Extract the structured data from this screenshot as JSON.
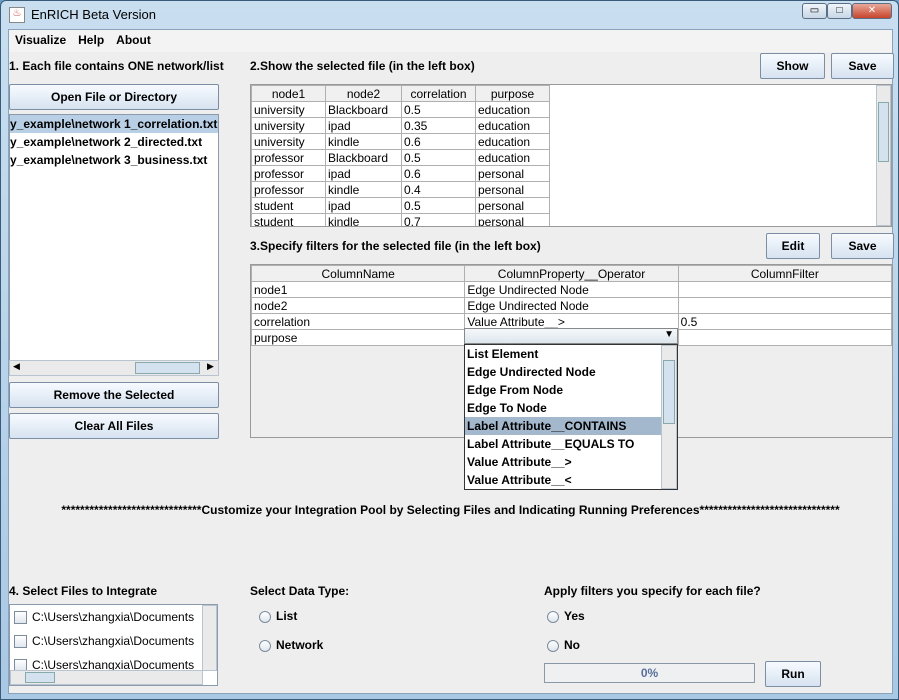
{
  "window": {
    "title": "EnRICH Beta Version",
    "min": "▭",
    "max": "□",
    "close": "✕"
  },
  "menu": [
    "Visualize",
    "Help",
    "About"
  ],
  "section1": {
    "label": "1. Each file contains ONE network/list",
    "open_button": "Open File or Directory",
    "files": [
      "y_example\\network 1_correlation.txt",
      "y_example\\network 2_directed.txt",
      "y_example\\network 3_business.txt"
    ],
    "remove_button": "Remove the Selected",
    "clear_button": "Clear All Files"
  },
  "section2": {
    "label": "2.Show the selected file (in the left box)",
    "show_button": "Show",
    "save_button": "Save",
    "columns": [
      "node1",
      "node2",
      "correlation",
      "purpose"
    ],
    "rows": [
      [
        "university",
        "Blackboard",
        "0.5",
        "education"
      ],
      [
        "university",
        "ipad",
        "0.35",
        "education"
      ],
      [
        "university",
        "kindle",
        "0.6",
        "education"
      ],
      [
        "professor",
        "Blackboard",
        "0.5",
        "education"
      ],
      [
        "professor",
        "ipad",
        "0.6",
        "personal"
      ],
      [
        "professor",
        "kindle",
        "0.4",
        "personal"
      ],
      [
        "student",
        "ipad",
        "0.5",
        "personal"
      ],
      [
        "student",
        "kindle",
        "0.7",
        "personal"
      ]
    ]
  },
  "section3": {
    "label": "3.Specify filters for the selected file (in the left box)",
    "edit_button": "Edit",
    "save_button": "Save",
    "columns": [
      "ColumnName",
      "ColumnProperty__Operator",
      "ColumnFilter"
    ],
    "rows": [
      [
        "node1",
        "Edge Undirected Node",
        ""
      ],
      [
        "node2",
        "Edge Undirected Node",
        ""
      ],
      [
        "correlation",
        "Value Attribute__>",
        "0.5"
      ],
      [
        "purpose",
        "",
        ""
      ]
    ],
    "dropdown_options": [
      "List Element",
      "Edge Undirected Node",
      "Edge From Node",
      "Edge To Node",
      "Label Attribute__CONTAINS",
      "Label Attribute__EQUALS TO",
      "Value Attribute__>",
      "Value Attribute__<"
    ],
    "highlighted_option": "Label Attribute__CONTAINS"
  },
  "banner": "******************************Customize your Integration Pool by Selecting Files and Indicating Running Preferences******************************",
  "section4": {
    "label": "4. Select Files to Integrate",
    "files": [
      "C:\\Users\\zhangxia\\Documents",
      "C:\\Users\\zhangxia\\Documents",
      "C:\\Users\\zhangxia\\Documents"
    ]
  },
  "data_type": {
    "label": "Select Data Type:",
    "options": [
      "List",
      "Network"
    ]
  },
  "apply_filters": {
    "label": "Apply filters you specify for each file?",
    "options": [
      "Yes",
      "No"
    ]
  },
  "progress": {
    "value": 0,
    "text": "0%"
  },
  "run_button": "Run",
  "colors": {
    "selection": "#b8cfe5",
    "highlight": "#a3b8cc",
    "progress_text": "#5a6f9a"
  }
}
